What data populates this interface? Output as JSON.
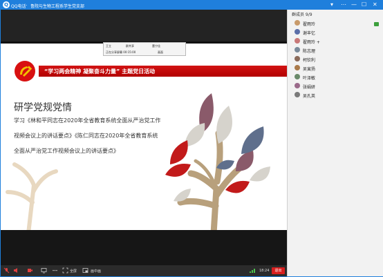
{
  "window": {
    "app_name": "QQ电话",
    "separator": "-",
    "group_name": "鲁院与生物工程系学生党支部",
    "controls": [
      "▾",
      "⋯",
      "—",
      "☐",
      "✕"
    ]
  },
  "members": {
    "header": "群成员 9/9",
    "list": [
      {
        "name": "翟雨玲",
        "color": "#c89a6a"
      },
      {
        "name": "谢丰忆",
        "color": "#5a6ea8"
      },
      {
        "name": "翟雨玲 +",
        "color": "#c87878"
      },
      {
        "name": "陈志理",
        "color": "#7a8a9a"
      },
      {
        "name": "柯钦利",
        "color": "#8a6a5a"
      },
      {
        "name": "吴寅扬",
        "color": "#aa7a4a"
      },
      {
        "name": "叶泽敏",
        "color": "#6a8a6a"
      },
      {
        "name": "张娟妍",
        "color": "#9a6a8a"
      },
      {
        "name": "吴孔英",
        "color": "#7a7a7a"
      }
    ]
  },
  "mini_toolbar": {
    "item1": "王立",
    "item2": "群共享",
    "item3": "董宁佳",
    "row2_left": "正在分享屏幕 00:15:00",
    "row2_right": "画面"
  },
  "slide": {
    "banner": "“学习两会精神 凝聚奋斗力量” 主题党日活动",
    "heading": "研学党规党情",
    "lines": [
      "学习《林和平同志在2020年全省教育系统全面从严治党工作",
      "视频会议上的讲话要点》《陈仁同志在2020年全省教育系统",
      "全面从严治党工作视频会议上的讲话要点》"
    ]
  },
  "bottom_bar": {
    "fullscreen": "全屏",
    "picture_in_picture": "画中画",
    "time": "18:24",
    "exit": "退出"
  },
  "colors": {
    "titlebar": "#1f7fdc",
    "banner_red": "#c40d0d",
    "exit_red": "#d81e1e"
  }
}
